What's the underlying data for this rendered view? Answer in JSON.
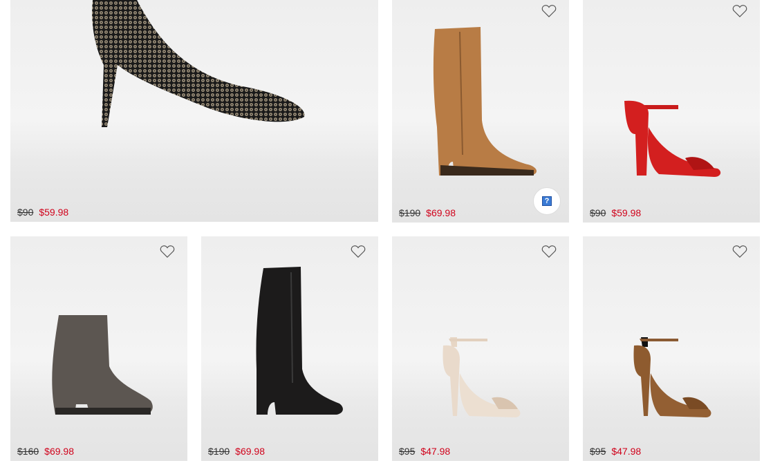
{
  "products": [
    {
      "orig": "$90",
      "sale": "$59.98",
      "image": "sequin-stiletto-pump"
    },
    {
      "orig": "$190",
      "sale": "$69.98",
      "image": "tan-knee-high-boot"
    },
    {
      "orig": "$90",
      "sale": "$59.98",
      "image": "red-block-heel-sandal"
    },
    {
      "orig": "$160",
      "sale": "$69.98",
      "image": "grey-ankle-bootie"
    },
    {
      "orig": "$190",
      "sale": "$69.98",
      "image": "black-knee-high-boot"
    },
    {
      "orig": "$95",
      "sale": "$47.98",
      "image": "nude-stiletto-sandal"
    },
    {
      "orig": "$95",
      "sale": "$47.98",
      "image": "cognac-stiletto-sandal"
    }
  ],
  "help_widget": {
    "glyph": "?"
  },
  "colors": {
    "sale": "#d0021b",
    "text": "#333333"
  }
}
